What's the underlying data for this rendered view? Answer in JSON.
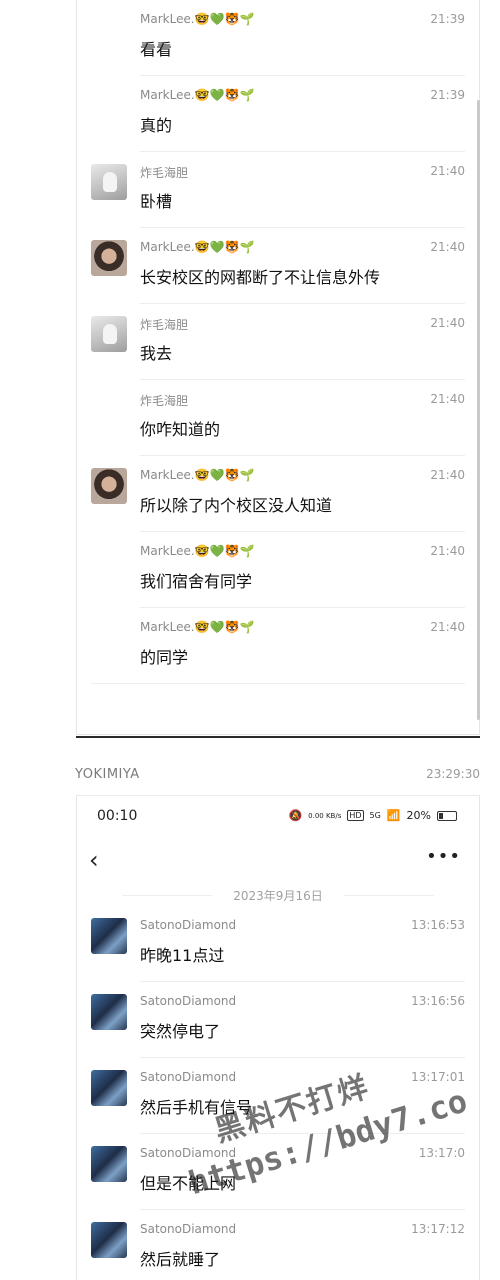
{
  "top_chat": {
    "messages": [
      {
        "name": "MarkLee.🤓💚🐯🌱",
        "time": "21:39",
        "text": "看看",
        "avatar": "none"
      },
      {
        "name": "MarkLee.🤓💚🐯🌱",
        "time": "21:39",
        "text": "真的",
        "avatar": "none"
      },
      {
        "name": "炸毛海胆",
        "time": "21:40",
        "text": "卧槽",
        "avatar": "cat"
      },
      {
        "name": "MarkLee.🤓💚🐯🌱",
        "time": "21:40",
        "text": "长安校区的网都断了不让信息外传",
        "avatar": "face"
      },
      {
        "name": "炸毛海胆",
        "time": "21:40",
        "text": "我去",
        "avatar": "cat"
      },
      {
        "name": "炸毛海胆",
        "time": "21:40",
        "text": "你咋知道的",
        "avatar": "none"
      },
      {
        "name": "MarkLee.🤓💚🐯🌱",
        "time": "21:40",
        "text": "所以除了内个校区没人知道",
        "avatar": "face"
      },
      {
        "name": "MarkLee.🤓💚🐯🌱",
        "time": "21:40",
        "text": "我们宿舍有同学",
        "avatar": "none"
      },
      {
        "name": "MarkLee.🤓💚🐯🌱",
        "time": "21:40",
        "text": "的同学",
        "avatar": "none"
      }
    ]
  },
  "post_header": {
    "user": "YOKIMIYA",
    "time": "23:29:30"
  },
  "phone": {
    "status": {
      "time": "00:10",
      "net": "0.00 KB/s",
      "hd": "HD",
      "signal": "5G",
      "battery": "20%"
    },
    "nav": {
      "back": "‹",
      "more": "•••"
    },
    "date": "2023年9月16日",
    "messages": [
      {
        "name": "SatonoDiamond",
        "time": "13:16:53",
        "text": "昨晚11点过"
      },
      {
        "name": "SatonoDiamond",
        "time": "13:16:56",
        "text": "突然停电了"
      },
      {
        "name": "SatonoDiamond",
        "time": "13:17:01",
        "text": "然后手机有信号"
      },
      {
        "name": "SatonoDiamond",
        "time": "13:17:0",
        "text": "但是不能上网"
      },
      {
        "name": "SatonoDiamond",
        "time": "13:17:12",
        "text": "然后就睡了"
      }
    ]
  },
  "watermark": {
    "line1": "黑料不打烊",
    "line2": "https://bdy7.co"
  }
}
